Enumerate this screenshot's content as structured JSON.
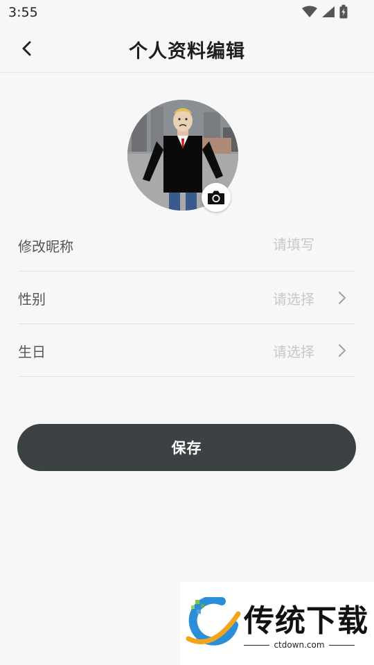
{
  "status_bar": {
    "time": "3:55"
  },
  "header": {
    "title": "个人资料编辑"
  },
  "form": {
    "nickname": {
      "label": "修改昵称",
      "placeholder": "请填写"
    },
    "gender": {
      "label": "性别",
      "value": "请选择"
    },
    "birthday": {
      "label": "生日",
      "value": "请选择"
    }
  },
  "actions": {
    "save_label": "保存"
  },
  "watermark": {
    "brand": "传统下载",
    "url": "ctdown.com"
  },
  "colors": {
    "button_bg": "#3c4244",
    "page_bg": "#f7f7f7",
    "placeholder": "#c8c8c8"
  },
  "icons": [
    "wifi-icon",
    "signal-icon",
    "battery-icon",
    "back-arrow-icon",
    "camera-icon",
    "chevron-right-icon",
    "ctdown-logo-icon"
  ]
}
